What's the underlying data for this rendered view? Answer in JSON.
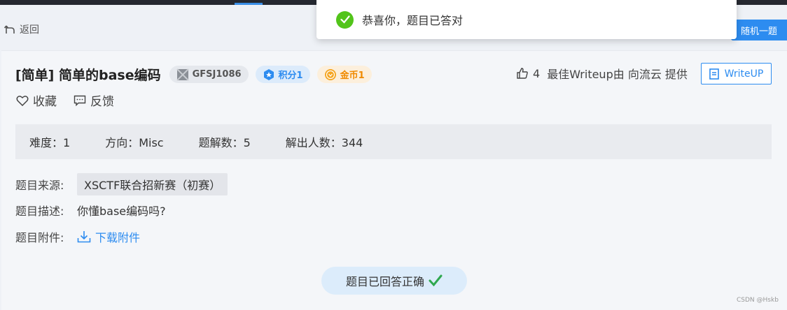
{
  "nav": {
    "back_label": "返回",
    "random_label": "随机一题"
  },
  "toast": {
    "message": "恭喜你，题目已答对"
  },
  "challenge": {
    "title": "[简单] 简单的base编码",
    "id_tag": "GFSJ1086",
    "score_tag": "积分1",
    "coin_tag": "金币1",
    "likes": "4",
    "writeup_info": "最佳Writeup由 向流云 提供",
    "writeup_button": "WriteUP",
    "favorite_label": "收藏",
    "feedback_label": "反馈"
  },
  "stats": {
    "difficulty": "难度：1",
    "direction": "方向：Misc",
    "solutions": "题解数：5",
    "solvers": "解出人数：344"
  },
  "details": {
    "source_label": "题目来源:",
    "source_value": "XSCTF联合招新赛（初赛）",
    "desc_label": "题目描述:",
    "desc_value": "你懂base编码吗?",
    "attach_label": "题目附件:",
    "attach_value": "下载附件"
  },
  "status": {
    "answered_label": "题目已回答正确"
  },
  "watermark": "CSDN @Hskb",
  "colors": {
    "primary": "#2d8cf0",
    "success": "#52c41a",
    "coin": "#f08a00"
  }
}
